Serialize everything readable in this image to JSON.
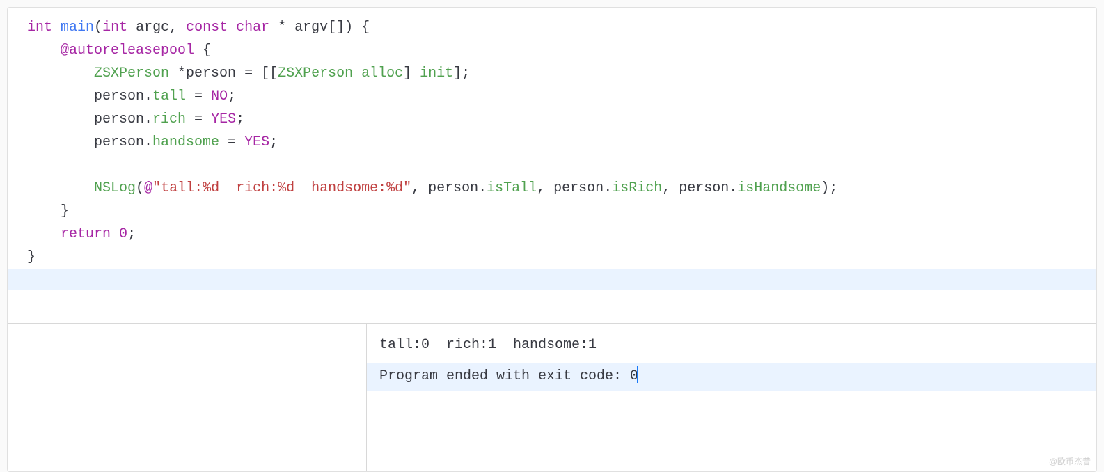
{
  "code": {
    "l1_kw_int": "int",
    "l1_fn_main": "main",
    "l1_paren_open": "(",
    "l1_kw_int2": "int",
    "l1_argc": " argc, ",
    "l1_kw_const": "const",
    "l1_sp": " ",
    "l1_kw_char": "char",
    "l1_argv": " * argv[]) {",
    "l2_at": "@autoreleasepool",
    "l2_brace": " {",
    "l3_cls1": "ZSXPerson",
    "l3_mid": " *person = [[",
    "l3_cls2": "ZSXPerson",
    "l3_sp": " ",
    "l3_alloc": "alloc",
    "l3_mid2": "] ",
    "l3_init": "init",
    "l3_end": "];",
    "l4_pre": "person.",
    "l4_prop": "tall",
    "l4_eq": " = ",
    "l4_val": "NO",
    "l4_semi": ";",
    "l5_pre": "person.",
    "l5_prop": "rich",
    "l5_eq": " = ",
    "l5_val": "YES",
    "l5_semi": ";",
    "l6_pre": "person.",
    "l6_prop": "handsome",
    "l6_eq": " = ",
    "l6_val": "YES",
    "l6_semi": ";",
    "l8_fn": "NSLog",
    "l8_open": "(",
    "l8_at": "@",
    "l8_str": "\"tall:%d  rich:%d  handsome:%d\"",
    "l8_mid1": ", person.",
    "l8_p1": "isTall",
    "l8_mid2": ", person.",
    "l8_p2": "isRich",
    "l8_mid3": ", person.",
    "l8_p3": "isHandsome",
    "l8_end": ");",
    "l9_brace": "}",
    "l10_ret": "return",
    "l10_sp": " ",
    "l10_zero": "0",
    "l10_semi": ";",
    "l11_brace": "}"
  },
  "console": {
    "line1": "tall:0  rich:1  handsome:1",
    "line2": "Program ended with exit code: 0"
  },
  "watermark": "@欧币杰昔"
}
